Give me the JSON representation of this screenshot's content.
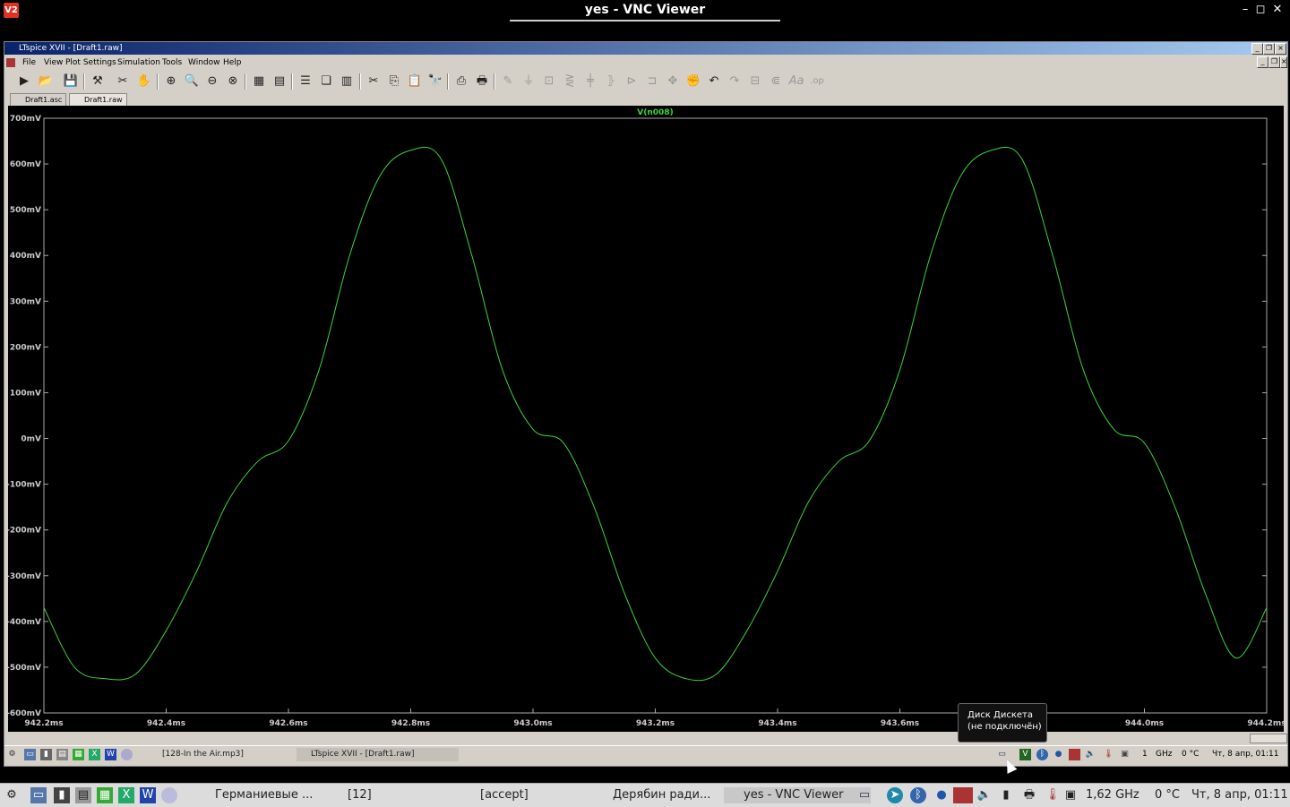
{
  "vnc": {
    "title": "yes - VNC Viewer",
    "icon": "V2",
    "min": "–",
    "max": "◻",
    "close": "✕"
  },
  "ltspice": {
    "title": "LTspice XVII - [Draft1.raw]",
    "menu": [
      "File",
      "View",
      "Plot Settings",
      "Simulation",
      "Tools",
      "Window",
      "Help"
    ],
    "tabs": [
      {
        "label": "Draft1.asc"
      },
      {
        "label": "Draft1.raw"
      }
    ]
  },
  "chart_data": {
    "type": "line",
    "title": "V(n008)",
    "xlabel": "",
    "ylabel": "",
    "xlim": [
      942.2,
      944.2
    ],
    "ylim": [
      -600,
      700
    ],
    "x_ticks": [
      "942.2ms",
      "942.4ms",
      "942.6ms",
      "942.8ms",
      "943.0ms",
      "943.2ms",
      "943.4ms",
      "943.6ms",
      "943.8ms",
      "944.0ms",
      "944.2ms"
    ],
    "y_ticks": [
      "700mV",
      "600mV",
      "500mV",
      "400mV",
      "300mV",
      "200mV",
      "100mV",
      "0mV",
      "-100mV",
      "-200mV",
      "-300mV",
      "-400mV",
      "-500mV",
      "-600mV"
    ],
    "grid": false,
    "series": [
      {
        "color": "#3bd63b",
        "x": [
          942.2,
          942.25,
          942.3,
          942.35,
          942.4,
          942.45,
          942.5,
          942.55,
          942.6,
          942.65,
          942.7,
          942.75,
          942.8,
          942.85,
          942.9,
          942.95,
          943.0,
          943.05,
          943.1,
          943.15,
          943.2,
          943.25,
          943.3,
          943.35,
          943.4,
          943.45,
          943.5,
          943.55,
          943.6,
          943.65,
          943.7,
          943.75,
          943.8,
          943.85,
          943.9,
          943.95,
          944.0,
          944.05,
          944.1,
          944.15,
          944.2
        ],
        "y": [
          -370,
          -500,
          -525,
          -515,
          -420,
          -290,
          -140,
          -50,
          -5,
          150,
          400,
          575,
          630,
          610,
          400,
          150,
          20,
          -10,
          -150,
          -340,
          -480,
          -525,
          -515,
          -420,
          -290,
          -140,
          -50,
          -5,
          150,
          400,
          575,
          630,
          610,
          400,
          150,
          20,
          -10,
          -150,
          -340,
          -480,
          -370
        ]
      }
    ]
  },
  "lt_taskbar": {
    "items": [
      {
        "label": "[128-In the Air.mp3]"
      },
      {
        "label": "LTspice XVII - [Draft1.raw]"
      }
    ],
    "tray_cpu": "1",
    "tray_freq": "GHz",
    "tray_temp": "0 °C",
    "clock": "Чт,  8 апр, 01:11"
  },
  "tooltip": {
    "line1": "Диск Дискета",
    "line2": "(не подключён)"
  },
  "host_taskbar": {
    "items": [
      {
        "label": "Германиевые ..."
      },
      {
        "label": "[12]"
      },
      {
        "label": "[accept]"
      },
      {
        "label": "Дерябин ради..."
      },
      {
        "label": "yes - VNC Viewer"
      }
    ],
    "cpu_freq": "1,62 GHz",
    "temp": "0 °C",
    "clock": "Чт,  8 апр, 01:11"
  }
}
